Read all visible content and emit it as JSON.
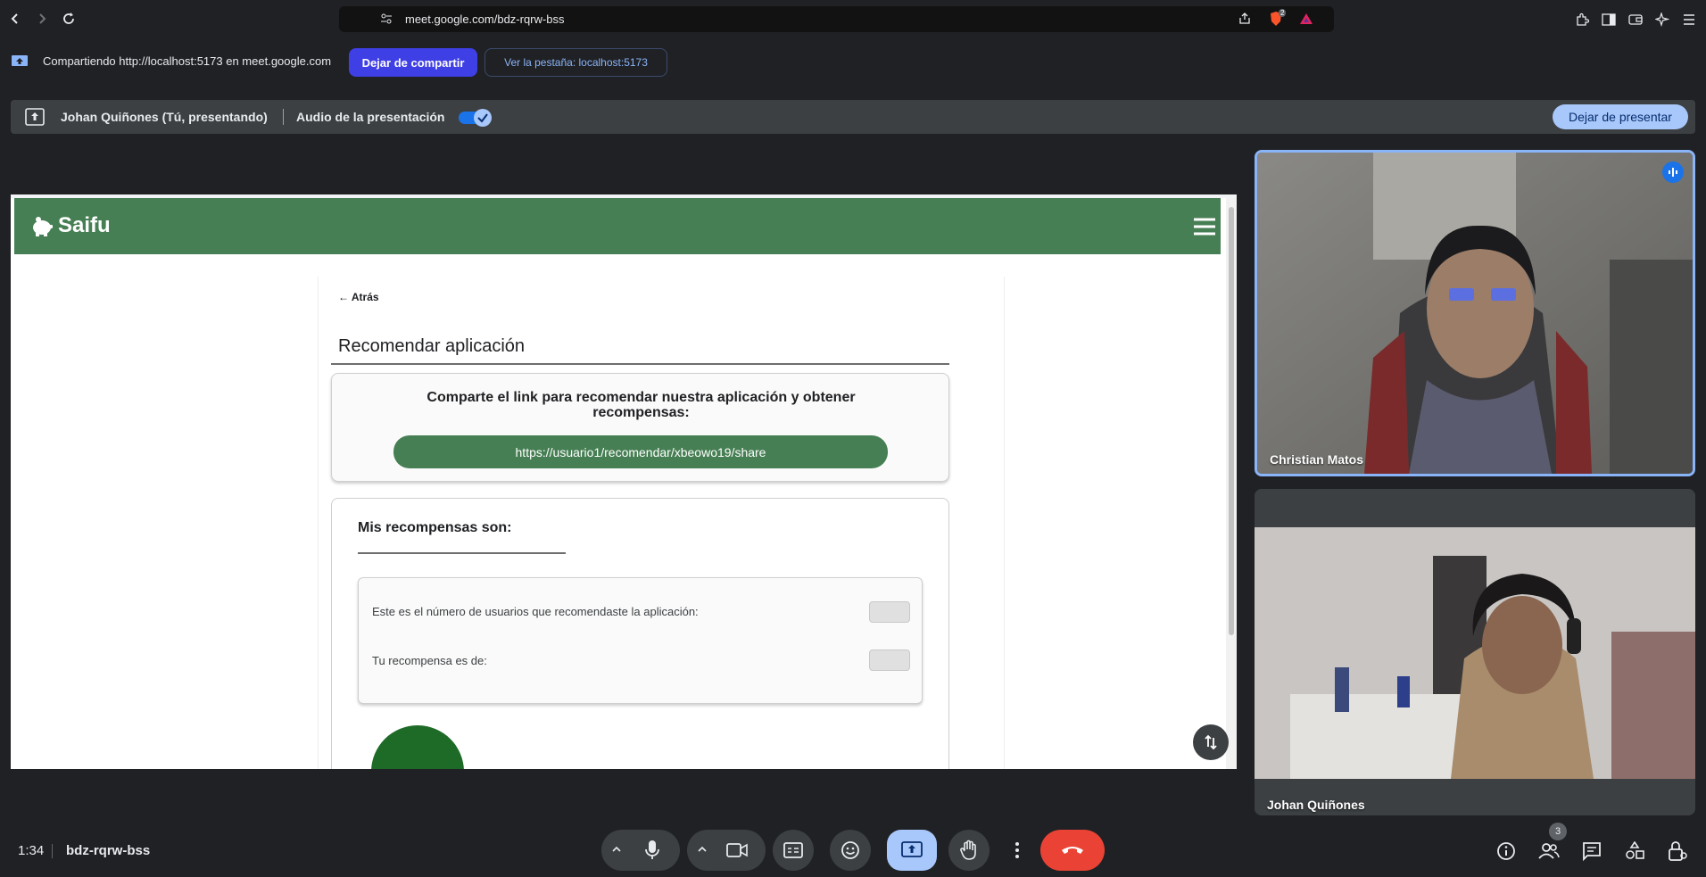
{
  "browser": {
    "url": "meet.google.com/bdz-rqrw-bss",
    "extension_badge": "2"
  },
  "share_bar": {
    "status_text": "Compartiendo http://localhost:5173 en meet.google.com",
    "stop_sharing_label": "Dejar de compartir",
    "view_tab_label": "Ver la pestaña: localhost:5173"
  },
  "present_bar": {
    "presenter": "Johan Quiñones (Tú, presentando)",
    "audio_label": "Audio de la presentación",
    "audio_enabled": true,
    "stop_presenting_label": "Dejar de presentar"
  },
  "shared_app": {
    "brand": "Saifu",
    "back_label": "← Atrás",
    "title": "Recomendar aplicación",
    "share_heading": "Comparte el link para recomendar nuestra aplicación y obtener recompensas:",
    "share_link": "https://usuario1/recomendar/xbeowo19/share",
    "rewards_heading": "Mis recompensas son:",
    "rewards_rows": [
      {
        "label": "Este es el número de usuarios que recomendaste la aplicación:",
        "value": ""
      },
      {
        "label": "Tu recompensa es de:",
        "value": ""
      }
    ]
  },
  "participants": [
    {
      "name": "Christian Matos",
      "speaking": true
    },
    {
      "name": "Johan Quiñones",
      "speaking": false
    }
  ],
  "bottom_bar": {
    "time": "1:34",
    "meeting_code": "bdz-rqrw-bss",
    "participant_count": "3"
  },
  "colors": {
    "app_green": "#467f53",
    "share_button": "#3f3fe6",
    "end_call": "#ea4335",
    "present_active": "#a8c7fa"
  }
}
